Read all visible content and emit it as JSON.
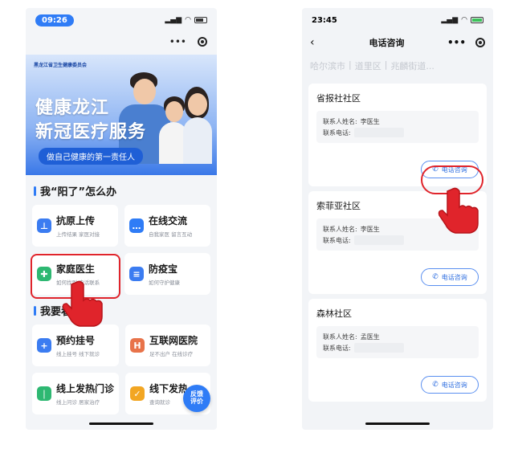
{
  "left": {
    "status_time": "09:26",
    "banner": {
      "org": "黑龙江省卫生健康委员会",
      "title1": "健康龙江",
      "title2": "新冠医疗服务",
      "slogan": "做自己健康的第一责任人"
    },
    "section1_title": "我“阳了”怎么办",
    "tiles1": [
      {
        "title": "抗原上传",
        "sub": "上传结果 家医对接",
        "icon": "test-tube-icon",
        "color": "#3b7cf1"
      },
      {
        "title": "在线交流",
        "sub": "自我家医 留言互动",
        "icon": "chat-icon",
        "color": "#2f7cf6"
      },
      {
        "title": "家庭医生",
        "sub": "如何找到 电话联系",
        "icon": "doctor-icon",
        "color": "#2eb872"
      },
      {
        "title": "防疫宝",
        "sub": "如何守护健康",
        "icon": "document-icon",
        "color": "#3b7cf1"
      }
    ],
    "section2_title": "我要看",
    "tiles2": [
      {
        "title": "预约挂号",
        "sub": "线上挂号 线下就诊",
        "icon": "plus-icon",
        "color": "#3b7cf1"
      },
      {
        "title": "互联网医院",
        "sub": "足不出户 在线诊疗",
        "icon": "hospital-icon",
        "color": "#e8734a"
      },
      {
        "title": "线上发热门诊",
        "sub": "线上问诊 居家治疗",
        "icon": "thermometer-icon",
        "color": "#2eb872"
      },
      {
        "title": "线下发热",
        "sub": "查询就诊",
        "icon": "clipboard-icon",
        "color": "#f2a623"
      }
    ],
    "fab_line1": "反馈",
    "fab_line2": "评价"
  },
  "right": {
    "status_time": "23:45",
    "nav_title": "电话咨询",
    "crumbs": [
      "哈尔滨市",
      "道里区",
      "兆麟街道..."
    ],
    "communities": [
      {
        "name": "省报社社区",
        "contact_label": "联系人姓名:",
        "contact": "李医生",
        "phone_label": "联系电话:",
        "button": "电话咨询"
      },
      {
        "name": "索菲亚社区",
        "contact_label": "联系人姓名:",
        "contact": "李医生",
        "phone_label": "联系电话:",
        "button": "电话咨询"
      },
      {
        "name": "森林社区",
        "contact_label": "联系人姓名:",
        "contact": "孟医生",
        "phone_label": "联系电话:",
        "button": "电话咨询"
      }
    ]
  },
  "colors": {
    "accent": "#2f7cf6",
    "highlight": "#e0242b"
  }
}
